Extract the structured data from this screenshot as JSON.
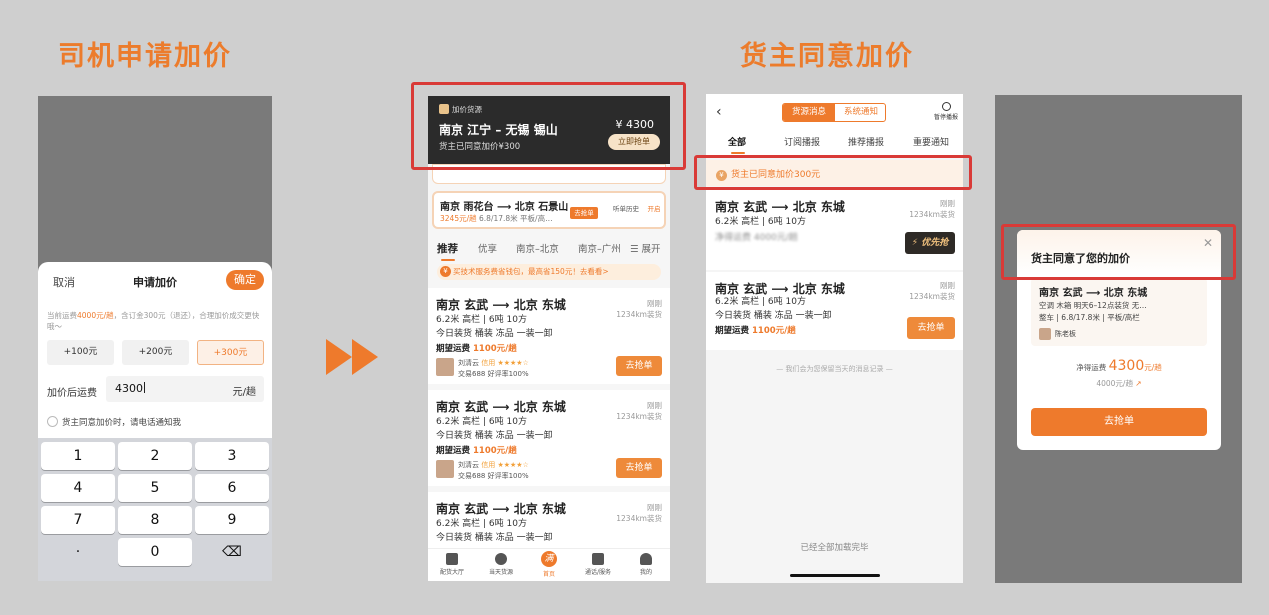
{
  "titles": {
    "left": "司机申请加价",
    "right": "货主同意加价"
  },
  "phone1": {
    "cancel": "取消",
    "title": "申请加价",
    "confirm": "确定",
    "tip_pre": "当前运费",
    "tip_amount": "4000元/趟",
    "tip_post": "，含订金300元（退还），合理加价成交更快哦～",
    "amounts": [
      "+100元",
      "+200元",
      "+300元"
    ],
    "price_label": "加价后运费",
    "price_value": "4300",
    "price_unit": "元/趟",
    "notify_label": "货主同意加价时，请电话通知我",
    "keys": [
      "1",
      "2",
      "3",
      "4",
      "5",
      "6",
      "7",
      "8",
      "9",
      "·",
      "0",
      "⌫"
    ]
  },
  "phone2": {
    "notif": {
      "tag": "加价货源",
      "route": "南京 江宁 – 无锡 锡山",
      "sub": "货主已同意加价¥300",
      "amount": "¥ 4300",
      "grab": "立即抢单"
    },
    "pinned": {
      "route": "南京 雨花台 ⟶ 北京 石景山",
      "price": "3245元/趟",
      "detail": "6.8/17.8米 平板/高…",
      "grab": "去抢单",
      "history": "听单历史",
      "open": "开启"
    },
    "tabs": [
      "推荐",
      "优享",
      "南京–北京",
      "南京–广州",
      "☰ 展开"
    ],
    "promo": "买技术服务费省钱包，最高省150元！去看看>",
    "cards": [
      {
        "route": "南京 玄武 ⟶ 北京 东城",
        "line1": "6.2米 高栏 | 6吨 10方",
        "line2": "今日装货  桶装  冻品  一装一卸",
        "price_label": "期望运费",
        "price": "1100元/趟",
        "time": "刚刚",
        "dist": "1234km装货",
        "name": "刘清云",
        "credit": "信用 ★★★★☆",
        "stats": "交易688  好评率100%",
        "grab": "去抢单"
      },
      {
        "route": "南京 玄武 ⟶ 北京 东城",
        "line1": "6.2米 高栏 | 6吨 10方",
        "line2": "今日装货  桶装  冻品  一装一卸",
        "price_label": "期望运费",
        "price": "1100元/趟",
        "time": "刚刚",
        "dist": "1234km装货",
        "name": "刘清云",
        "credit": "信用 ★★★★☆",
        "stats": "交易688  好评率100%",
        "grab": "去抢单"
      },
      {
        "route": "南京 玄武 ⟶ 北京 东城",
        "line1": "6.2米 高栏 | 6吨 10方",
        "line2": "今日装货  桶装  冻品  一装一卸",
        "time": "刚刚",
        "dist": "1234km装货"
      }
    ],
    "nav": [
      "配货大厅",
      "当天货源",
      "首页",
      "通话/服务",
      "我的"
    ],
    "home_glyph": "满"
  },
  "phone3": {
    "back": "‹",
    "seg": [
      "货源消息",
      "系统通知"
    ],
    "pause": "暂停播报",
    "tabs": [
      "全部",
      "订阅播报",
      "推荐播报",
      "重要通知"
    ],
    "notice": "货主已同意加价300元",
    "cards": [
      {
        "route": "南京 玄武 ⟶ 北京 东城",
        "line1": "6.2米 高栏 | 6吨 10方",
        "price": "净得运费 4000元/趟",
        "time": "刚刚",
        "dist": "1234km装货",
        "grab": "⚡ 优先抢"
      },
      {
        "route": "南京 玄武 ⟶ 北京 东城",
        "line1": "6.2米 高栏 | 6吨 10方",
        "line2": "今日装货  桶装  冻品  一装一卸",
        "price_label": "期望运费",
        "price": "1100元/趟",
        "time": "刚刚",
        "dist": "1234km装货",
        "grab": "去抢单"
      }
    ],
    "foot": "— 我们会为您保留当天的消息记录 —",
    "end": "已经全部加载完毕"
  },
  "phone4": {
    "title": "货主同意了您的加价",
    "close": "✕",
    "route": "南京 玄武 ⟶ 北京 东城",
    "line1": "空调  木箱  明天6–12点装货  无…",
    "line2": "整车 | 6.8/17.8米 | 平板/高栏",
    "owner": "陈老板",
    "net_label": "净得运费",
    "net_value": "4300",
    "net_unit": "元/趟",
    "old_value": "4000元/趟",
    "button": "去抢单"
  }
}
